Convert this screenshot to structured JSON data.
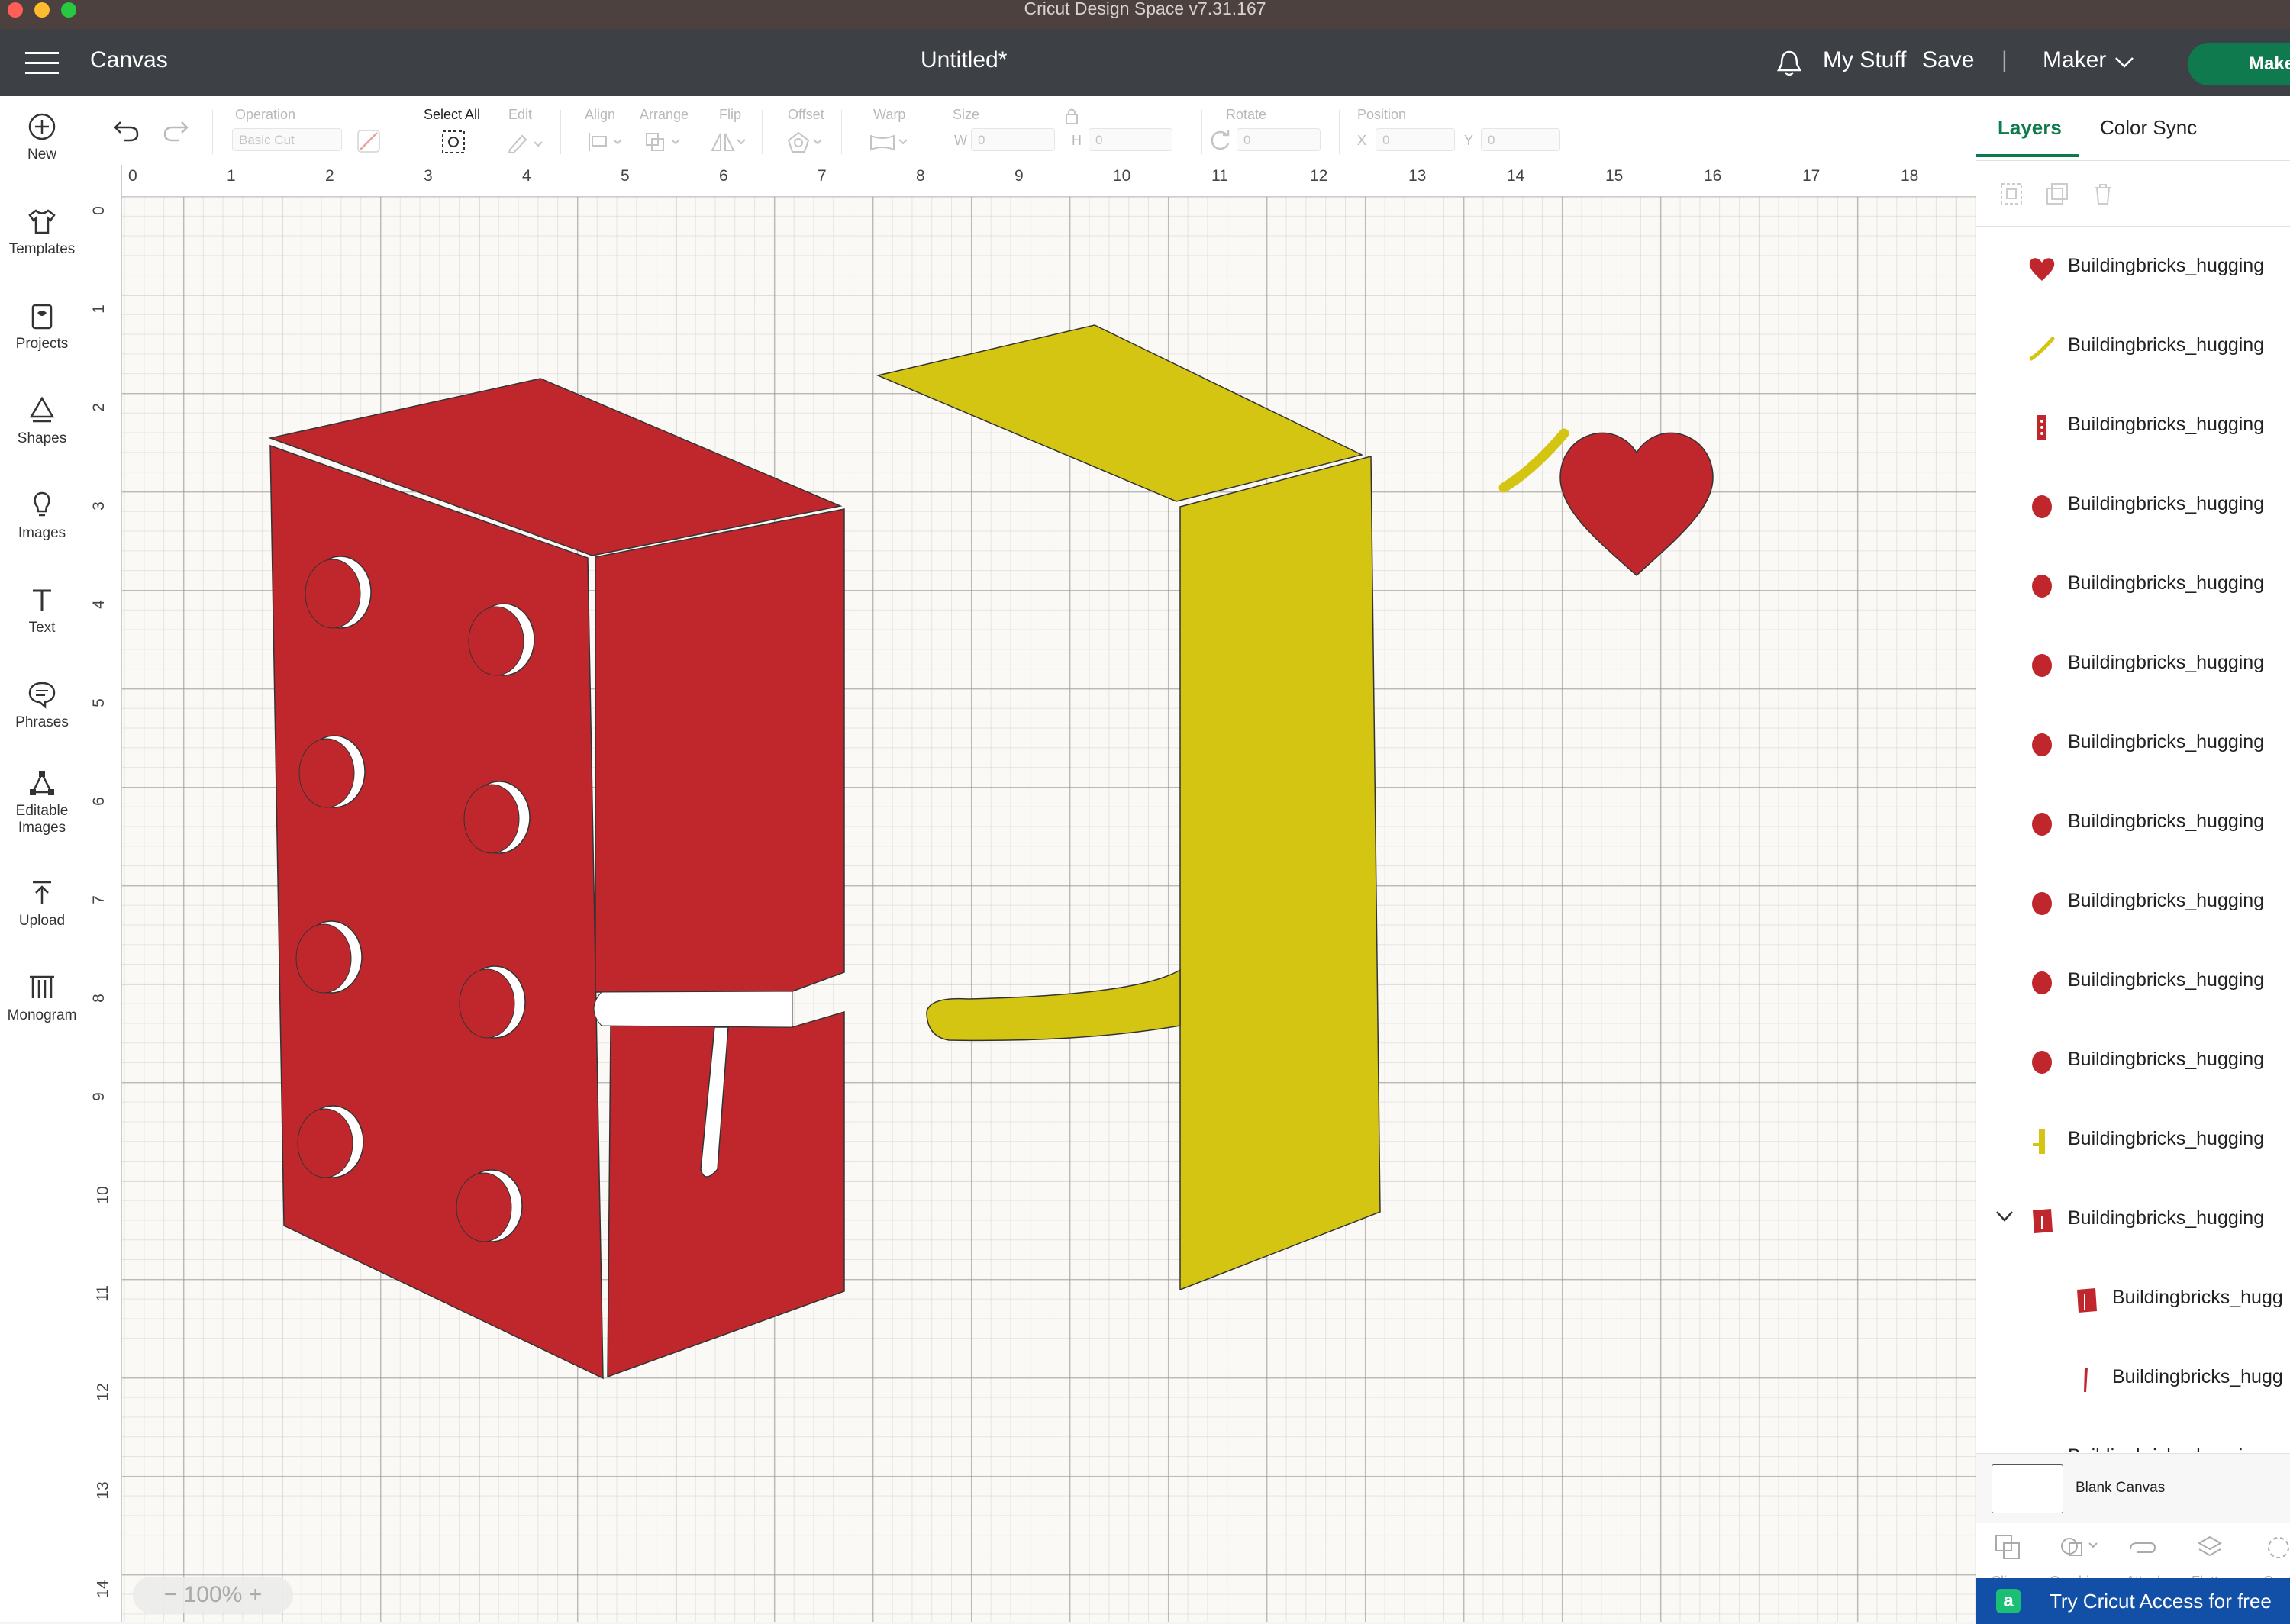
{
  "window": {
    "title": "Cricut Design Space  v7.31.167"
  },
  "header": {
    "section": "Canvas",
    "doc_title": "Untitled*",
    "my_stuff": "My Stuff",
    "save": "Save",
    "separator": "|",
    "machine": "Maker",
    "make_button": "Make"
  },
  "left_rail": {
    "items": [
      {
        "label": "New",
        "icon": "plus-circle-icon"
      },
      {
        "label": "Templates",
        "icon": "tshirt-icon"
      },
      {
        "label": "Projects",
        "icon": "projects-icon"
      },
      {
        "label": "Shapes",
        "icon": "shapes-icon"
      },
      {
        "label": "Images",
        "icon": "lightbulb-icon"
      },
      {
        "label": "Text",
        "icon": "text-icon"
      },
      {
        "label": "Phrases",
        "icon": "speech-bubble-icon"
      },
      {
        "label": "Editable",
        "label2": "Images",
        "icon": "editable-images-icon"
      },
      {
        "label": "Upload",
        "icon": "upload-icon"
      },
      {
        "label": "Monogram",
        "icon": "monogram-icon"
      }
    ]
  },
  "toolbar": {
    "operation_label": "Operation",
    "operation_value": "Basic Cut",
    "select_all": "Select All",
    "edit": "Edit",
    "align": "Align",
    "arrange": "Arrange",
    "flip": "Flip",
    "offset": "Offset",
    "warp": "Warp",
    "size": "Size",
    "w_label": "W",
    "w_value": "0",
    "h_label": "H",
    "h_value": "0",
    "rotate": "Rotate",
    "rotate_value": "0",
    "position": "Position",
    "x_label": "X",
    "x_value": "0",
    "y_label": "Y",
    "y_value": "0"
  },
  "ruler": {
    "h": [
      "0",
      "1",
      "2",
      "3",
      "4",
      "5",
      "6",
      "7",
      "8",
      "9",
      "10",
      "11",
      "12",
      "13",
      "14",
      "15",
      "16",
      "17",
      "18"
    ],
    "v": [
      "0",
      "1",
      "2",
      "3",
      "4",
      "5",
      "6",
      "7",
      "8",
      "9",
      "10",
      "11",
      "12",
      "13",
      "14"
    ]
  },
  "zoom": {
    "value": "100%",
    "minus": "−",
    "plus": "+"
  },
  "right_panel": {
    "tabs": [
      "Layers",
      "Color Sync"
    ],
    "layer_name": "Buildingbricks_hugging",
    "layers": [
      {
        "icon": "heart-icon",
        "color": "#c0272d"
      },
      {
        "icon": "curve-icon",
        "color": "#d4c512"
      },
      {
        "icon": "brick-strip-icon",
        "color": "#c0272d"
      },
      {
        "icon": "circle-icon",
        "color": "#c0272d"
      },
      {
        "icon": "circle-icon",
        "color": "#c0272d"
      },
      {
        "icon": "circle-icon",
        "color": "#c0272d"
      },
      {
        "icon": "circle-icon",
        "color": "#c0272d"
      },
      {
        "icon": "circle-icon",
        "color": "#c0272d"
      },
      {
        "icon": "circle-icon",
        "color": "#c0272d"
      },
      {
        "icon": "circle-icon",
        "color": "#c0272d"
      },
      {
        "icon": "circle-icon",
        "color": "#c0272d"
      },
      {
        "icon": "yellow-bar-icon",
        "color": "#d4c512"
      },
      {
        "icon": "red-group-icon",
        "color": "#c0272d",
        "expanded": true
      },
      {
        "icon": "red-panel-icon",
        "color": "#c0272d",
        "child": true,
        "label": "Buildingbricks_hugg"
      },
      {
        "icon": "red-sliver-icon",
        "color": "#c0272d",
        "child": true,
        "label": "Buildingbricks_hugg"
      },
      {
        "icon": "yellow-cut-icon",
        "color": "#d4c512",
        "label": "Buildingbricks_hugging"
      }
    ],
    "blank_canvas": "Blank Canvas",
    "actions": [
      "Slice",
      "Combine",
      "Attach",
      "Flatten",
      "Cont"
    ],
    "banner": "Try Cricut Access for free"
  },
  "colors": {
    "brick_red": "#c0272d",
    "brick_yellow": "#d4c512",
    "header_bg": "#3d4045",
    "make_green": "#0f7a4e",
    "accent": "#0f7a4e"
  }
}
